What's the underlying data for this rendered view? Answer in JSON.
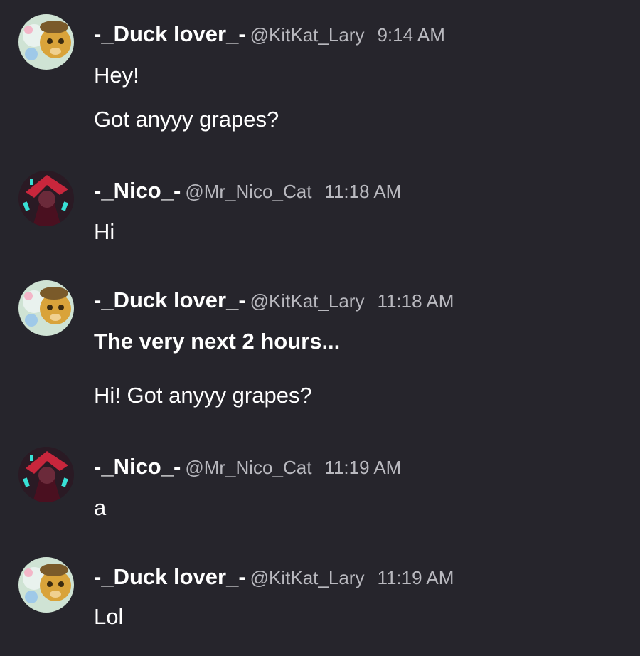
{
  "messages": [
    {
      "author": "-_Duck lover_-",
      "handle": "@KitKat_Lary",
      "time": "9:14 AM",
      "avatar": "duck-lover-avatar",
      "lines": [
        {
          "text": "Hey!",
          "bold": false
        },
        {
          "text": "Got anyyy grapes?",
          "bold": false
        }
      ]
    },
    {
      "author": "-_Nico_-",
      "handle": "@Mr_Nico_Cat",
      "time": "11:18 AM",
      "avatar": "nico-avatar",
      "lines": [
        {
          "text": "Hi",
          "bold": false
        }
      ]
    },
    {
      "author": "-_Duck lover_-",
      "handle": "@KitKat_Lary",
      "time": "11:18 AM",
      "avatar": "duck-lover-avatar",
      "lines": [
        {
          "text": "The very next 2 hours...",
          "bold": true
        },
        {
          "text": "Hi! Got anyyy grapes?",
          "bold": false
        }
      ]
    },
    {
      "author": "-_Nico_-",
      "handle": "@Mr_Nico_Cat",
      "time": "11:19 AM",
      "avatar": "nico-avatar",
      "lines": [
        {
          "text": "a",
          "bold": false
        }
      ]
    },
    {
      "author": "-_Duck lover_-",
      "handle": "@KitKat_Lary",
      "time": "11:19 AM",
      "avatar": "duck-lover-avatar",
      "lines": [
        {
          "text": "Lol",
          "bold": false
        }
      ]
    }
  ],
  "colors": {
    "background": "#26252c",
    "text": "#ffffff",
    "muted": "#b9b9bf"
  }
}
